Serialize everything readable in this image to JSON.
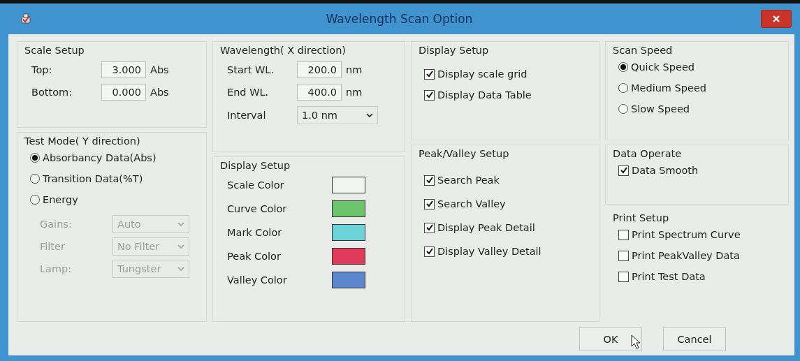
{
  "window": {
    "title": "Wavelength Scan Option"
  },
  "scale_setup": {
    "title": "Scale Setup",
    "fields": [
      {
        "label": "Top:",
        "value": "3.000",
        "unit": "Abs"
      },
      {
        "label": "Bottom:",
        "value": "0.000",
        "unit": "Abs"
      }
    ]
  },
  "test_mode": {
    "title": "Test Mode( Y direction)",
    "options": [
      {
        "label": "Absorbancy Data(Abs)",
        "selected": true
      },
      {
        "label": "Transition Data(%T)",
        "selected": false
      },
      {
        "label": "Energy",
        "selected": false
      }
    ],
    "settings": [
      {
        "label": "Gains:",
        "value": "Auto",
        "disabled": true
      },
      {
        "label": "Filter",
        "value": "No Filter",
        "disabled": true
      },
      {
        "label": "Lamp:",
        "value": "Tungster",
        "disabled": true
      }
    ]
  },
  "wavelength": {
    "title": "Wavelength( X direction)",
    "fields": [
      {
        "label": "Start WL.",
        "value": "200.0",
        "unit": "nm"
      },
      {
        "label": "End WL.",
        "value": "400.0",
        "unit": "nm"
      }
    ],
    "interval": {
      "label": "Interval",
      "value": "1.0 nm"
    }
  },
  "color_setup": {
    "title": "Display Setup",
    "items": [
      {
        "label": "Scale Color",
        "color": "#f2f4f2"
      },
      {
        "label": "Curve Color",
        "color": "#6cc46c"
      },
      {
        "label": "Mark Color",
        "color": "#6cd4d8"
      },
      {
        "label": "Peak Color",
        "color": "#e03c5a"
      },
      {
        "label": "Valley Color",
        "color": "#5b86cc"
      }
    ]
  },
  "display_setup": {
    "title": "Display Setup",
    "options": [
      {
        "label": "Display scale grid",
        "checked": true
      },
      {
        "label": "Display Data Table",
        "checked": true
      }
    ]
  },
  "peak_valley_setup": {
    "title": "Peak/Valley Setup",
    "options": [
      {
        "label": "Search Peak",
        "checked": true
      },
      {
        "label": "Search Valley",
        "checked": true
      },
      {
        "label": "Display Peak Detail",
        "checked": true
      },
      {
        "label": "Display Valley Detail",
        "checked": true
      }
    ]
  },
  "scan_speed": {
    "title": "Scan Speed",
    "options": [
      {
        "label": "Quick Speed",
        "selected": true
      },
      {
        "label": "Medium Speed",
        "selected": false
      },
      {
        "label": "Slow Speed",
        "selected": false
      }
    ]
  },
  "data_operate": {
    "title": "Data Operate",
    "options": [
      {
        "label": "Data Smooth",
        "checked": true
      }
    ]
  },
  "print_setup": {
    "title": "Print Setup",
    "options": [
      {
        "label": "Print Spectrum Curve",
        "checked": false
      },
      {
        "label": "Print PeakValley Data",
        "checked": false
      },
      {
        "label": "Print Test Data",
        "checked": false
      }
    ]
  },
  "buttons": [
    {
      "label": "OK"
    },
    {
      "label": "Cancel"
    }
  ]
}
